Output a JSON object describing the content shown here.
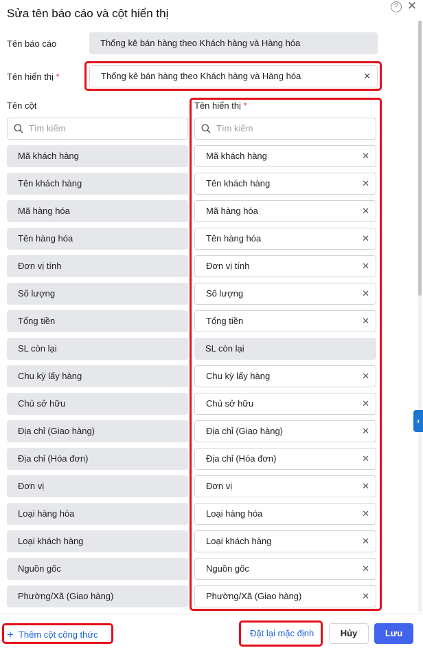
{
  "dialog": {
    "title": "Sửa tên báo cáo và cột hiển thị",
    "help_icon": "question-circle-icon",
    "close_icon": "close-icon"
  },
  "report": {
    "name_label": "Tên báo cáo",
    "name_value": "Thống kê bán hàng theo Khách hàng và Hàng hóa",
    "display_label": "Tên hiển thị",
    "display_value": "Thống kê bán hàng theo Khách hàng và Hàng hóa",
    "required_mark": "*"
  },
  "columns": {
    "col_header": "Tên cột",
    "display_header": "Tên hiển thị",
    "search_placeholder": "Tìm kiếm",
    "rows": [
      {
        "name": "Mã khách hàng",
        "display": "Mã khách hàng",
        "editable": true
      },
      {
        "name": "Tên khách hàng",
        "display": "Tên khách hàng",
        "editable": true
      },
      {
        "name": "Mã hàng hóa",
        "display": "Mã hàng hóa",
        "editable": true
      },
      {
        "name": "Tên hàng hóa",
        "display": "Tên hàng hóa",
        "editable": true
      },
      {
        "name": "Đơn vị tính",
        "display": "Đơn vị tính",
        "editable": true
      },
      {
        "name": "Số lượng",
        "display": "Số lượng",
        "editable": true
      },
      {
        "name": "Tổng tiền",
        "display": "Tổng tiền",
        "editable": true
      },
      {
        "name": "SL còn lại",
        "display": "SL còn lại",
        "editable": false
      },
      {
        "name": "Chu kỳ lấy hàng",
        "display": "Chu kỳ lấy hàng",
        "editable": true
      },
      {
        "name": "Chủ sở hữu",
        "display": "Chủ sở hữu",
        "editable": true
      },
      {
        "name": "Địa chỉ (Giao hàng)",
        "display": "Địa chỉ (Giao hàng)",
        "editable": true
      },
      {
        "name": "Địa chỉ (Hóa đơn)",
        "display": "Địa chỉ (Hóa đơn)",
        "editable": true
      },
      {
        "name": "Đơn vị",
        "display": "Đơn vị",
        "editable": true
      },
      {
        "name": "Loại hàng hóa",
        "display": "Loại hàng hóa",
        "editable": true
      },
      {
        "name": "Loại khách hàng",
        "display": "Loại khách hàng",
        "editable": true
      },
      {
        "name": "Nguồn gốc",
        "display": "Nguồn gốc",
        "editable": true
      },
      {
        "name": "Phường/Xã (Giao hàng)",
        "display": "Phường/Xã (Giao hàng)",
        "editable": true
      }
    ]
  },
  "footer": {
    "add_formula_label": "Thêm cột công thức",
    "reset_label": "Đặt lại mặc định",
    "cancel_label": "Hủy",
    "save_label": "Lưu"
  },
  "colors": {
    "highlight": "#e3101a",
    "primary": "#4263eb",
    "link": "#1a5fe0"
  }
}
